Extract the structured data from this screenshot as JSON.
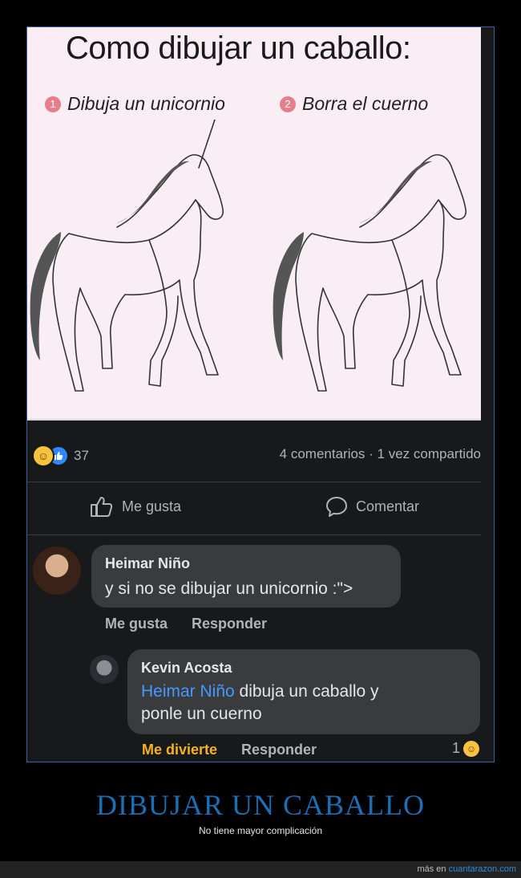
{
  "meme": {
    "title": "Como dibujar un caballo:",
    "step1_num": "1",
    "step1_label": "Dibuja un unicornio",
    "step2_num": "2",
    "step2_label": "Borra el cuerno"
  },
  "post": {
    "reaction_count": "37",
    "stats": "4 comentarios · 1 vez compartido",
    "like_label": "Me gusta",
    "comment_label": "Comentar"
  },
  "comments": [
    {
      "name": "Heimar Niño",
      "text": "y si no se dibujar un unicornio :\">",
      "actions": [
        "Me gusta",
        "Responder"
      ]
    },
    {
      "name": "Kevin Acosta",
      "mention": "Heimar Niño",
      "text_line1": " dibuja un caballo y",
      "text_line2": "ponle un cuerno",
      "actions": [
        "Me divierte",
        "Responder"
      ],
      "reaction_count": "1"
    }
  ],
  "caption": {
    "title": "DIBUJAR UN CABALLO",
    "subtitle": "No tiene mayor complicación"
  },
  "footer": {
    "prefix": "más en ",
    "link": "cuantarazon.com"
  },
  "colors": {
    "brand_blue": "#1a6fb5",
    "facebook_blue": "#2d88ff",
    "haha_yellow": "#f7c23f",
    "mention_blue": "#4599ff",
    "dark_bg": "#18191a"
  }
}
